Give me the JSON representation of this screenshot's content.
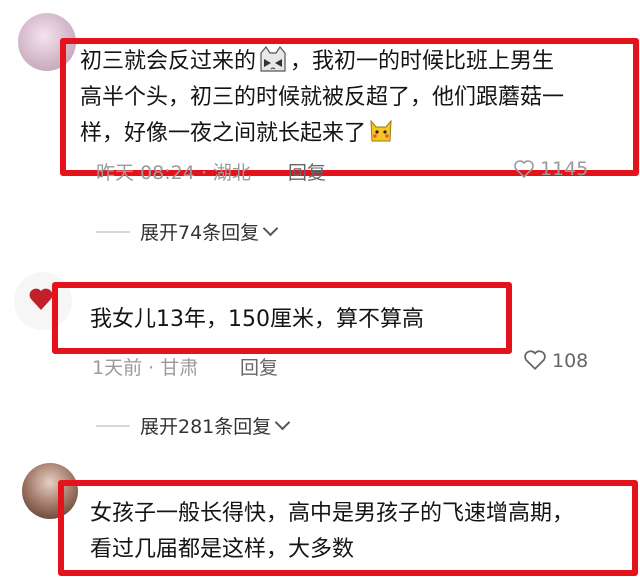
{
  "comments": [
    {
      "text_lines": [
        "初三就会反过来的",
        "，我初一的时候比班上男生",
        "高半个头，初三的时候就被反超了，他们跟蘑菇一",
        "样，好像一夜之间就长起来了"
      ],
      "meta": "昨天 08:24 · 湖北",
      "reply_label": "回复",
      "likes": "1145",
      "expand_label": "展开74条回复"
    },
    {
      "text_lines": [
        "我女儿13年，150厘米，算不算高"
      ],
      "meta": "1天前 · 甘肃",
      "reply_label": "回复",
      "likes": "108",
      "expand_label": "展开281条回复"
    },
    {
      "text_lines": [
        "女孩子一般长得快，高中是男孩子的飞速增高期，",
        "看过几届都是这样，大多数"
      ]
    }
  ],
  "colors": {
    "highlight": "#e5121b",
    "meta": "#9a9a9a"
  },
  "icons": [
    "cat-emoji-icon",
    "pikachu-emoji-icon",
    "heart-icon",
    "chevron-down-icon"
  ]
}
